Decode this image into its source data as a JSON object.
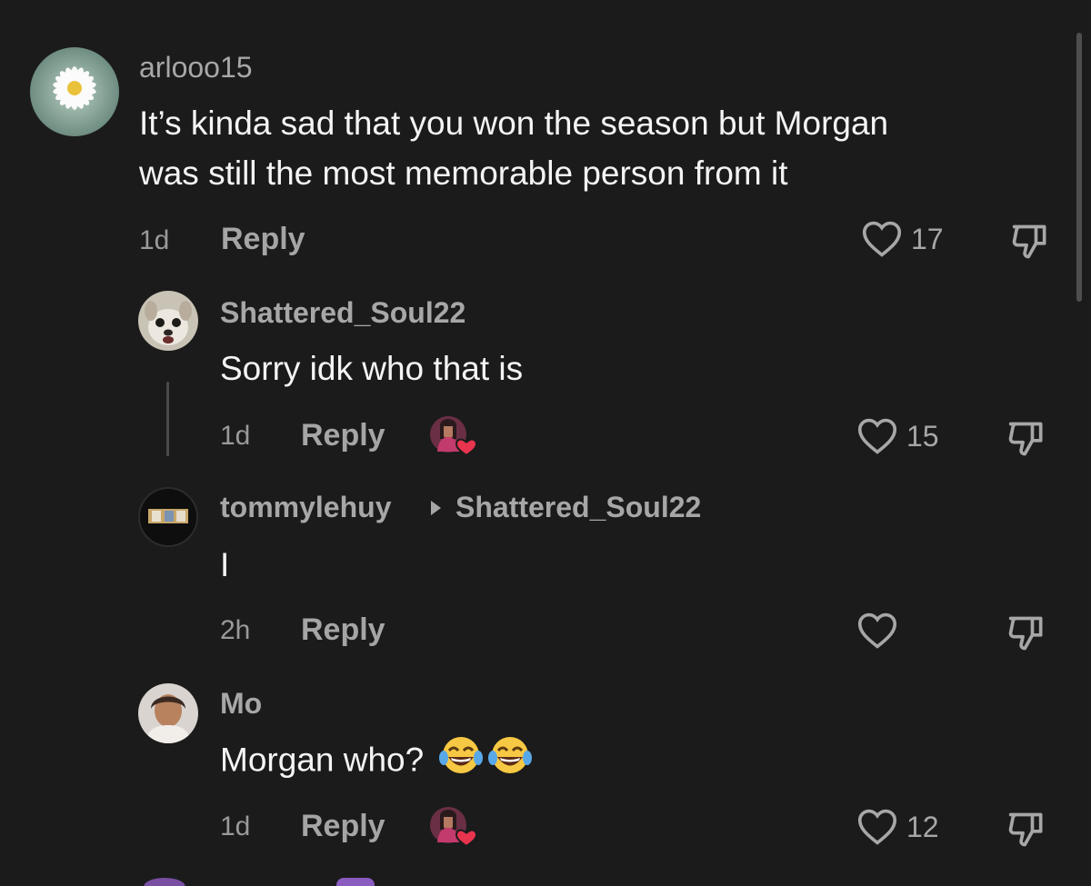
{
  "comments": [
    {
      "username": "arlooo15",
      "text_line1": "It’s kinda sad that you won the season but Morgan",
      "text_line2": "was still the most memorable person from it",
      "time": "1d",
      "reply_label": "Reply",
      "likes": "17",
      "avatar_icon": "daisy-avatar"
    },
    {
      "username": "Shattered_Soul22",
      "text": "Sorry idk who that is",
      "time": "1d",
      "reply_label": "Reply",
      "likes": "15",
      "creator_liked": true,
      "avatar_icon": "dog-avatar"
    },
    {
      "username": "tommylehuy",
      "reply_to": "Shattered_Soul22",
      "text": "I",
      "time": "2h",
      "reply_label": "Reply",
      "likes": "",
      "avatar_icon": "photo-avatar"
    },
    {
      "username": "Mo",
      "text": "Morgan who?",
      "text_emoji": "😂😂",
      "time": "1d",
      "reply_label": "Reply",
      "likes": "12",
      "creator_liked": true,
      "avatar_icon": "person-avatar"
    }
  ],
  "colors": {
    "background": "#1b1b1b",
    "text": "#f4f4f4",
    "muted": "#a7a7a7",
    "heart_badge": "#e8344e"
  }
}
